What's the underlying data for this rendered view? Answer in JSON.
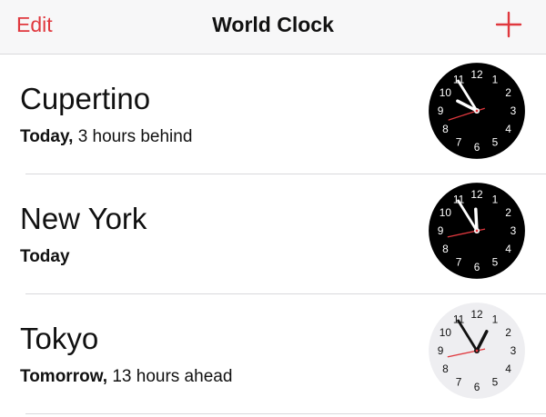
{
  "navbar": {
    "edit_label": "Edit",
    "title": "World Clock",
    "add_icon": "plus-icon"
  },
  "colors": {
    "accent": "#e0383e",
    "dark_face": "#000000",
    "light_face": "#eeeef1"
  },
  "clocks": [
    {
      "city": "Cupertino",
      "day": "Today,",
      "offset": " 3 hours behind",
      "theme": "dark",
      "hour": 9,
      "minute": 54,
      "second": 42
    },
    {
      "city": "New York",
      "day": "Today",
      "offset": "",
      "theme": "dark",
      "hour": 11,
      "minute": 54,
      "second": 43
    },
    {
      "city": "Tokyo",
      "day": "Tomorrow,",
      "offset": " 13 hours ahead",
      "theme": "light",
      "hour": 12,
      "minute": 54,
      "second": 43
    }
  ]
}
